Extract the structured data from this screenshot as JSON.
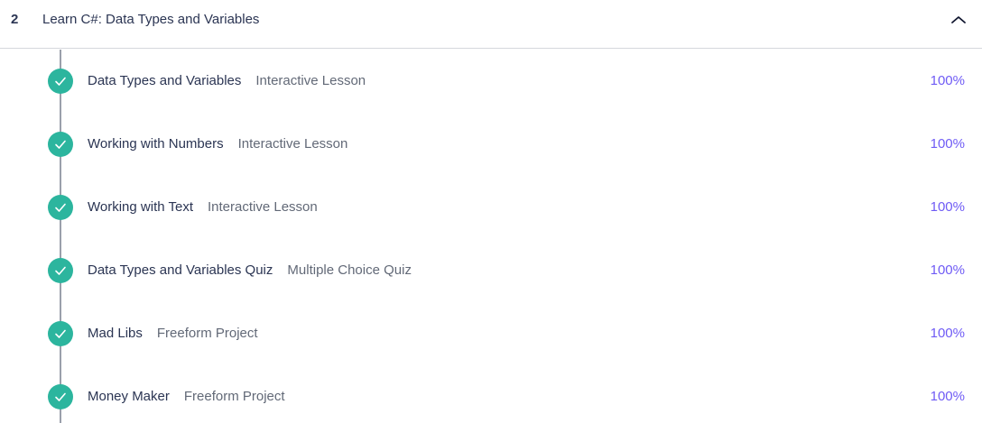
{
  "module": {
    "number": "2",
    "title": "Learn C#: Data Types and Variables",
    "collapse_icon": "chevron-up-icon"
  },
  "lessons": [
    {
      "title": "Data Types and Variables",
      "type": "Interactive Lesson",
      "progress": "100%",
      "status_icon": "check-icon"
    },
    {
      "title": "Working with Numbers",
      "type": "Interactive Lesson",
      "progress": "100%",
      "status_icon": "check-icon"
    },
    {
      "title": "Working with Text",
      "type": "Interactive Lesson",
      "progress": "100%",
      "status_icon": "check-icon"
    },
    {
      "title": "Data Types and Variables Quiz",
      "type": "Multiple Choice Quiz",
      "progress": "100%",
      "status_icon": "check-icon"
    },
    {
      "title": "Mad Libs",
      "type": "Freeform Project",
      "progress": "100%",
      "status_icon": "check-icon"
    },
    {
      "title": "Money Maker",
      "type": "Freeform Project",
      "progress": "100%",
      "status_icon": "check-icon"
    }
  ],
  "colors": {
    "complete": "#2cb59e",
    "progress_text": "#6f5bf5",
    "title_text": "#2b3553",
    "type_text": "#626977"
  }
}
